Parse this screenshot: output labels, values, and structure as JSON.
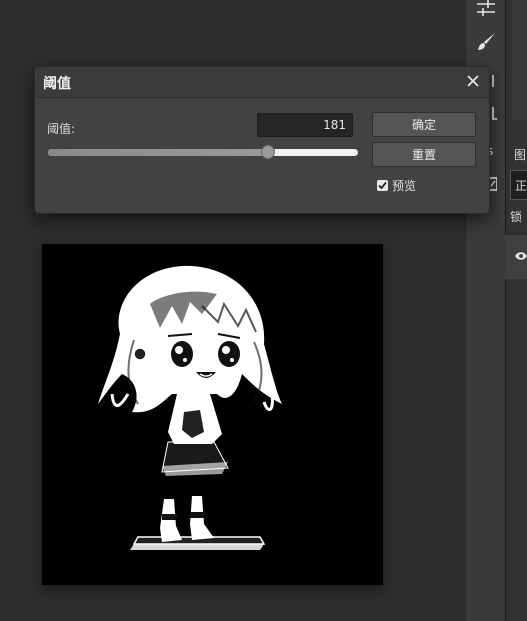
{
  "dialog": {
    "title": "阈值",
    "field_label": "阈值:",
    "threshold_value": "181",
    "slider_fraction": 0.71,
    "ok_label": "确定",
    "reset_label": "重置",
    "preview_label": "预览",
    "preview_checked": true
  },
  "side_panel": {
    "tab_label": "图",
    "blend_mode": "正",
    "lock_label": "锁",
    "partial_label": "s"
  },
  "icons": {
    "close": "close-icon",
    "adjustments": "sliders-icon",
    "brush": "brush-icon",
    "checkmark": "checkmark-icon",
    "eye": "eye-icon"
  },
  "colors": {
    "workspace": "#2d2d2d",
    "dialog": "#424242",
    "button": "#555555",
    "input": "#252525"
  }
}
